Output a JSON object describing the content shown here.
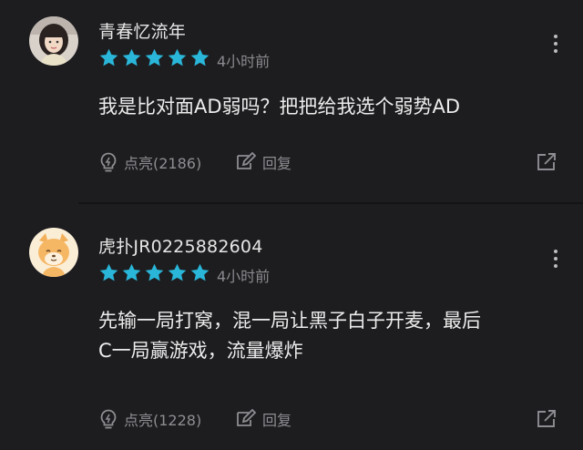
{
  "comments": [
    {
      "username": "青春忆流年",
      "rating": 5,
      "time": "4小时前",
      "text_lines": [
        "我是比对面AD弱吗？把把给我选个弱势AD"
      ],
      "like_label": "点亮(2186)",
      "reply_label": "回复",
      "avatar": "girl-photo-avatar"
    },
    {
      "username": "虎扑JR0225882604",
      "rating": 5,
      "time": "4小时前",
      "text_lines": [
        "先输一局打窝，混一局让黑子白子开麦，最后",
        "C一局赢游戏，流量爆炸"
      ],
      "like_label": "点亮(1228)",
      "reply_label": "回复",
      "avatar": "cartoon-dog-avatar"
    }
  ],
  "colors": {
    "background": "#1d1d20",
    "star": "#29b6d8",
    "muted_text": "#8a8a8e"
  },
  "icons": [
    "star-icon",
    "more-vertical-icon",
    "lightbulb-icon",
    "reply-edit-icon",
    "share-icon"
  ]
}
